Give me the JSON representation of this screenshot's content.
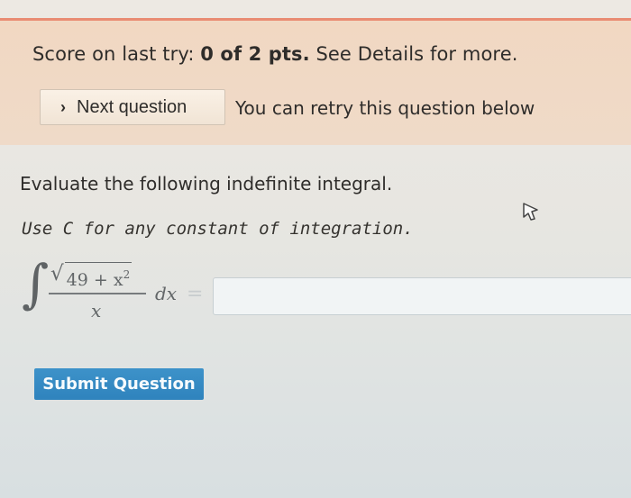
{
  "status": {
    "score_prefix": "Score on last try: ",
    "score_value": "0 of 2 pts.",
    "score_suffix": " See Details for more.",
    "next_button_label": "Next question",
    "retry_note": "You can retry this question below"
  },
  "question": {
    "prompt": "Evaluate the following indefinite integral.",
    "instruction": "Use C for any constant of integration.",
    "integral": {
      "radicand_base": "49 + x",
      "exponent": "2",
      "denominator": "x",
      "differential": "dx",
      "equals": "="
    },
    "answer": {
      "value": "",
      "placeholder": ""
    }
  },
  "actions": {
    "submit_label": "Submit Question"
  },
  "colors": {
    "status_accent": "#e98c73",
    "status_background": "#f1d8c2",
    "submit_background": "#3d92c9"
  },
  "icons": {
    "next": "chevron-right-icon",
    "cursor": "mouse-pointer-icon"
  }
}
